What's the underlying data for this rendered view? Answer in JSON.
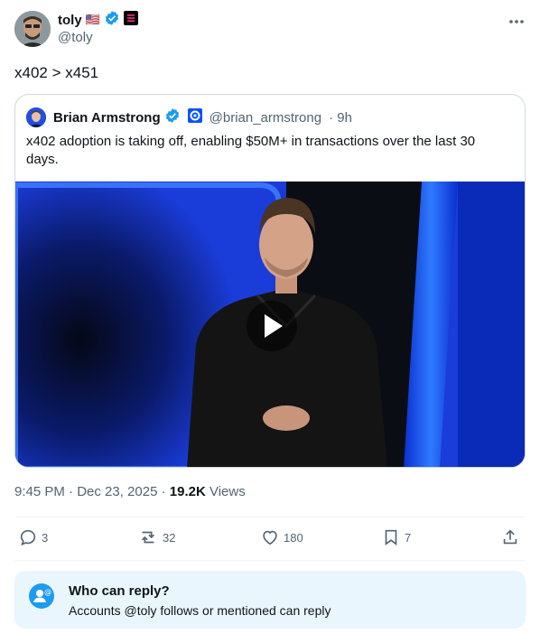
{
  "author": {
    "display_name": "toly",
    "handle": "@toly",
    "flag": "🇺🇸",
    "verified_color": "#1d9bf0"
  },
  "post": {
    "text": "x402 > x451",
    "timestamp": "9:45 PM · Dec 23, 2025 · ",
    "views_count": "19.2K",
    "views_label": "Views"
  },
  "quote": {
    "display_name": "Brian Armstrong",
    "handle": "@brian_armstrong",
    "time": "· 9h",
    "text": "x402 adoption is taking off, enabling $50M+ in transactions over the last 30 days."
  },
  "actions": {
    "replies": "3",
    "reposts": "32",
    "likes": "180",
    "bookmarks": "7"
  },
  "reply_settings": {
    "title": "Who can reply?",
    "subtitle": "Accounts @toly follows or mentioned can reply"
  },
  "colors": {
    "accent": "#1d9bf0",
    "text_secondary": "#536471",
    "reply_box_bg": "#eaf6fd"
  }
}
